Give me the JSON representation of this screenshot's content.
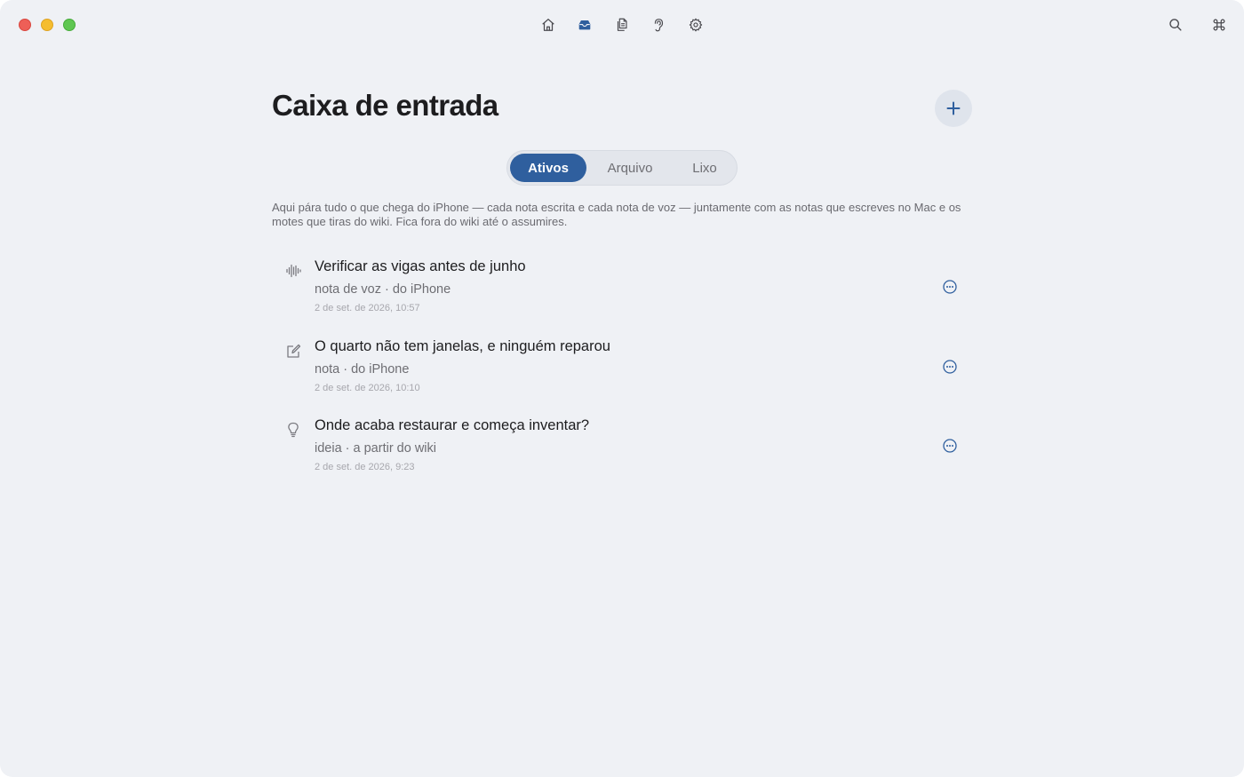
{
  "window": {
    "traffic_lights": [
      "close",
      "minimize",
      "zoom"
    ]
  },
  "toolbar": {
    "icons": [
      "home-icon",
      "inbox-icon",
      "documents-icon",
      "ear-icon",
      "gear-icon"
    ],
    "active": "inbox-icon",
    "right_icons": [
      "search-icon",
      "command-icon"
    ]
  },
  "main": {
    "title": "Caixa de entrada",
    "add_symbol": "+",
    "tabs": [
      {
        "label": "Ativos",
        "active": true
      },
      {
        "label": "Arquivo",
        "active": false
      },
      {
        "label": "Lixo",
        "active": false
      }
    ],
    "description": "Aqui pára tudo o que chega do iPhone — cada nota escrita e cada nota de voz — juntamente com as notas que escreves no Mac e os motes que tiras do wiki. Fica fora do wiki até o assumires.",
    "items": [
      {
        "icon": "waveform-icon",
        "title": "Verificar as vigas antes de junho",
        "meta": "nota de voz · do iPhone",
        "date": "2 de set. de 2026, 10:57"
      },
      {
        "icon": "compose-icon",
        "title": "O quarto não tem janelas, e ninguém reparou",
        "meta": "nota · do iPhone",
        "date": "2 de set. de 2026, 10:10"
      },
      {
        "icon": "lightbulb-icon",
        "title": "Onde acaba restaurar e começa inventar?",
        "meta": "ideia · a partir do wiki",
        "date": "2 de set. de 2026, 9:23"
      }
    ]
  },
  "colors": {
    "accent": "#2f5f9e",
    "background": "#eff1f5"
  }
}
